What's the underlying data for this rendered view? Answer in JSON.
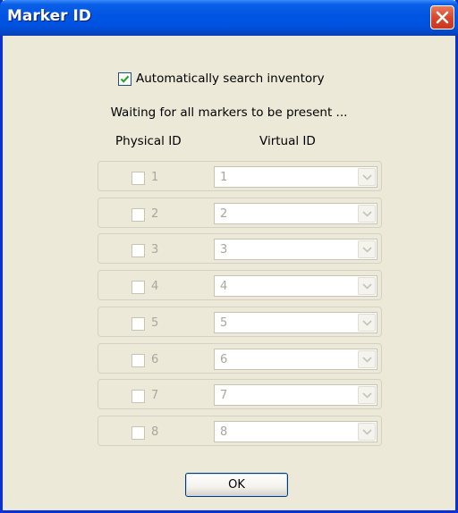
{
  "window": {
    "title": "Marker ID",
    "colors": {
      "titlebar": "#0054E3",
      "face": "#ECE9D8",
      "close": "#D9472B"
    }
  },
  "auto_search": {
    "label": "Automatically search inventory",
    "checked": true
  },
  "status": "Waiting for all markers to be present ...",
  "columns": {
    "physical": "Physical ID",
    "virtual": "Virtual ID"
  },
  "rows": [
    {
      "physical": "1",
      "virtual": "1"
    },
    {
      "physical": "2",
      "virtual": "2"
    },
    {
      "physical": "3",
      "virtual": "3"
    },
    {
      "physical": "4",
      "virtual": "4"
    },
    {
      "physical": "5",
      "virtual": "5"
    },
    {
      "physical": "6",
      "virtual": "6"
    },
    {
      "physical": "7",
      "virtual": "7"
    },
    {
      "physical": "8",
      "virtual": "8"
    }
  ],
  "buttons": {
    "ok": "OK"
  },
  "icons": {
    "close": "close-icon",
    "check": "checkmark-icon",
    "dropdown": "chevron-down-icon"
  }
}
